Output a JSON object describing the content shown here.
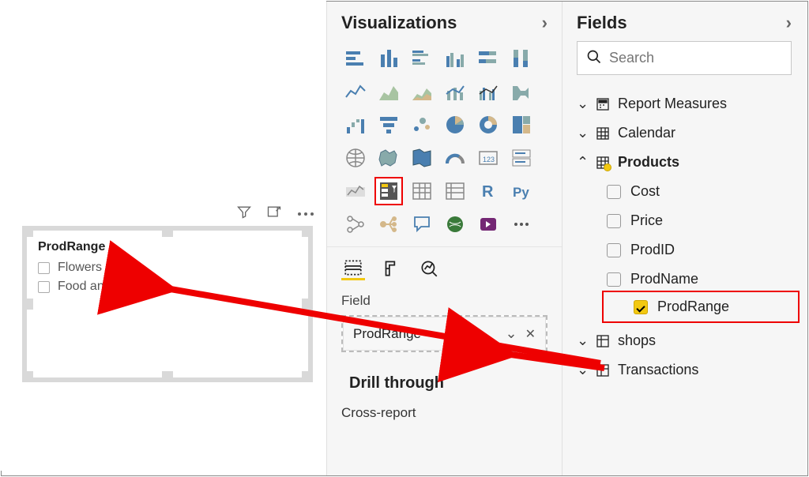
{
  "slicer": {
    "title": "ProdRange",
    "items": [
      "Flowers",
      "Food and Drink"
    ]
  },
  "visualizations": {
    "title": "Visualizations",
    "field_label": "Field",
    "well_item": "ProdRange",
    "drill_title": "Drill through",
    "cross_report": "Cross-report",
    "icons": [
      "stacked-bar",
      "stacked-column",
      "clustered-bar",
      "clustered-column",
      "100-bar",
      "100-column",
      "",
      "line",
      "area",
      "stacked-area",
      "line-column",
      "line-clustered",
      "ribbon",
      "",
      "waterfall",
      "funnel",
      "scatter",
      "pie",
      "donut",
      "treemap",
      "",
      "map",
      "filled-map",
      "shape-map",
      "gauge",
      "card",
      "multi-card",
      "",
      "kpi",
      "slicer",
      "table",
      "matrix",
      "r",
      "py",
      "",
      "key-influencers",
      "decomposition",
      "qa",
      "paginated",
      "powerapps",
      "more",
      ""
    ]
  },
  "fields": {
    "title": "Fields",
    "search_placeholder": "Search",
    "tables": [
      {
        "name": "Report Measures",
        "expanded": false,
        "icon": "measures"
      },
      {
        "name": "Calendar",
        "expanded": false,
        "icon": "table"
      },
      {
        "name": "Products",
        "expanded": true,
        "icon": "table",
        "columns": [
          {
            "name": "Cost",
            "checked": false
          },
          {
            "name": "Price",
            "checked": false
          },
          {
            "name": "ProdID",
            "checked": false
          },
          {
            "name": "ProdName",
            "checked": false
          },
          {
            "name": "ProdRange",
            "checked": true
          }
        ]
      },
      {
        "name": "shops",
        "expanded": false,
        "icon": "table"
      },
      {
        "name": "Transactions",
        "expanded": false,
        "icon": "table"
      }
    ]
  }
}
